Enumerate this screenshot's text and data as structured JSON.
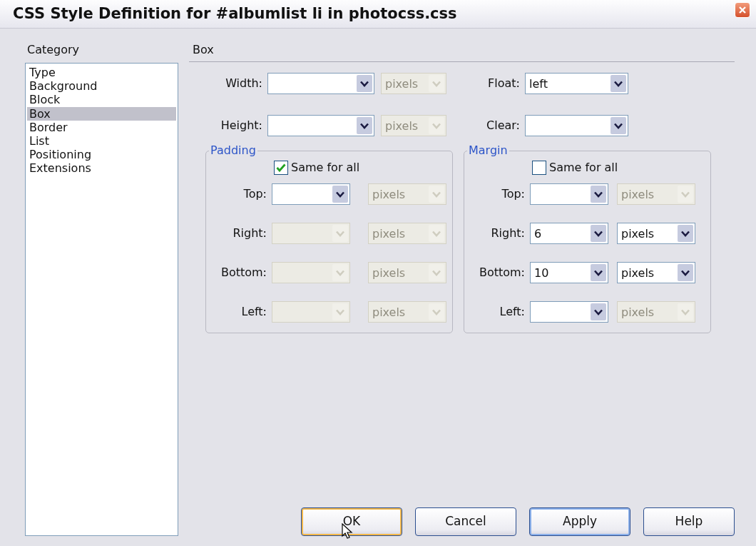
{
  "window": {
    "title": "CSS Style Definition for #albumlist li in photocss.css"
  },
  "category": {
    "label": "Category",
    "items": [
      {
        "label": "Type",
        "selected": false
      },
      {
        "label": "Background",
        "selected": false
      },
      {
        "label": "Block",
        "selected": false
      },
      {
        "label": "Box",
        "selected": true
      },
      {
        "label": "Border",
        "selected": false
      },
      {
        "label": "List",
        "selected": false
      },
      {
        "label": "Positioning",
        "selected": false
      },
      {
        "label": "Extensions",
        "selected": false
      }
    ]
  },
  "section": {
    "title": "Box"
  },
  "size_fields": [
    {
      "label": "Width:",
      "disabled": false,
      "unit": {
        "value": "pixels",
        "disabled": true
      }
    },
    {
      "label": "Height:",
      "disabled": false,
      "unit": {
        "value": "pixels",
        "disabled": true
      }
    }
  ],
  "layout_fields": [
    {
      "label": "Float:",
      "value": "left",
      "disabled": false
    },
    {
      "label": "Clear:",
      "disabled": false
    }
  ],
  "groups": [
    {
      "title": "Padding",
      "same_for_all": {
        "label": "Same for all",
        "checked": true
      },
      "rows": [
        {
          "label": "Top:",
          "disabled": false,
          "unit": {
            "value": "pixels",
            "disabled": true
          }
        },
        {
          "label": "Right:",
          "disabled": true,
          "unit": {
            "value": "pixels",
            "disabled": true
          }
        },
        {
          "label": "Bottom:",
          "disabled": true,
          "unit": {
            "value": "pixels",
            "disabled": true
          }
        },
        {
          "label": "Left:",
          "disabled": true,
          "unit": {
            "value": "pixels",
            "disabled": true
          }
        }
      ]
    },
    {
      "title": "Margin",
      "same_for_all": {
        "label": "Same for all",
        "checked": false
      },
      "rows": [
        {
          "label": "Top:",
          "disabled": false,
          "unit": {
            "value": "pixels",
            "disabled": true
          }
        },
        {
          "label": "Right:",
          "value": "6",
          "disabled": false,
          "unit": {
            "value": "pixels",
            "disabled": false
          }
        },
        {
          "label": "Bottom:",
          "value": "10",
          "disabled": false,
          "unit": {
            "value": "pixels",
            "disabled": false
          }
        },
        {
          "label": "Left:",
          "disabled": false,
          "unit": {
            "value": "pixels",
            "disabled": true
          }
        }
      ]
    }
  ],
  "buttons": [
    {
      "label": "OK",
      "hovered": true,
      "default": false
    },
    {
      "label": "Cancel",
      "hovered": false,
      "default": false
    },
    {
      "label": "Apply",
      "hovered": false,
      "default": true
    },
    {
      "label": "Help",
      "hovered": false,
      "default": false
    }
  ]
}
